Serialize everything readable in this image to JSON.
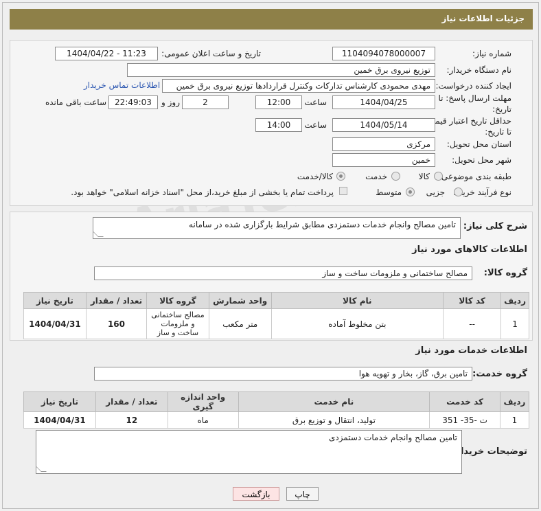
{
  "header": {
    "title": "جزئیات اطلاعات نیاز"
  },
  "form": {
    "need_number_label": "شماره نیاز:",
    "need_number": "1104094078000007",
    "announce_label": "تاریخ و ساعت اعلان عمومی:",
    "announce_value": "1404/04/22 - 11:23",
    "buyer_org_label": "نام دستگاه خریدار:",
    "buyer_org": "توزیع نیروی برق خمین",
    "creator_label": "ایجاد کننده درخواست:",
    "creator": "مهدی محمودی کارشناس تدارکات وکنترل قراردادها توزیع نیروی برق خمین",
    "contact_link": "اطلاعات تماس خریدار",
    "deadline_label_1": "مهلت ارسال پاسخ: تا",
    "deadline_label_2": "تاریخ:",
    "deadline_date": "1404/04/25",
    "time_label": "ساعت",
    "deadline_time": "12:00",
    "days_value": "2",
    "days_label": "روز و",
    "remaining_time": "22:49:03",
    "remaining_label": "ساعت باقی مانده",
    "price_label_1": "حداقل تاریخ اعتبار قیمت:",
    "price_label_2": "تا تاریخ:",
    "price_date": "1404/05/14",
    "price_time": "14:00",
    "province_label": "استان محل تحویل:",
    "province": "مرکزی",
    "city_label": "شهر محل تحویل:",
    "city": "خمین",
    "category_label": "طبقه بندی موضوعی:",
    "category_options": [
      "کالا",
      "خدمت",
      "کالا/خدمت"
    ],
    "process_label": "نوع فرآیند خرید :",
    "process_options": [
      "جزیی",
      "متوسط"
    ],
    "payment_note": "پرداخت تمام یا بخشی از مبلغ خرید،از محل \"اسناد خزانه اسلامی\" خواهد بود."
  },
  "description": {
    "label": "شرح کلی نیاز:",
    "value": "تامین مصالح وانجام خدمات دستمزدی  مطابق شرایط بارگزاری شده در سامانه"
  },
  "goods": {
    "section_title": "اطلاعات کالاهای مورد نیاز",
    "group_label": "گروه کالا:",
    "group_value": "مصالح ساختمانی و ملزومات ساخت و ساز",
    "columns": [
      "ردیف",
      "کد کالا",
      "نام کالا",
      "واحد شمارش",
      "گروه کالا",
      "تعداد / مقدار",
      "تاریخ نیاز"
    ],
    "rows": [
      [
        "1",
        "--",
        "بتن مخلوط آماده",
        "متر مکعب",
        "مصالح ساختمانی و ملزومات ساخت و ساز",
        "160",
        "1404/04/31"
      ]
    ]
  },
  "services": {
    "section_title": "اطلاعات خدمات مورد نیاز",
    "group_label": "گروه خدمت:",
    "group_value": "تامین برق، گاز، بخار و تهویه هوا",
    "columns": [
      "ردیف",
      "کد خدمت",
      "نام خدمت",
      "واحد اندازه گیری",
      "تعداد / مقدار",
      "تاریخ نیاز"
    ],
    "rows": [
      [
        "1",
        "ت -35- 351",
        "تولید، انتقال و توزیع برق",
        "ماه",
        "12",
        "1404/04/31"
      ]
    ]
  },
  "buyer_notes": {
    "label": "توضیحات خریدار:",
    "value": "تامین مصالح وانجام خدمات دستمزدی"
  },
  "buttons": {
    "print": "چاپ",
    "back": "بازگشت"
  },
  "watermark": "AriaTender.net"
}
